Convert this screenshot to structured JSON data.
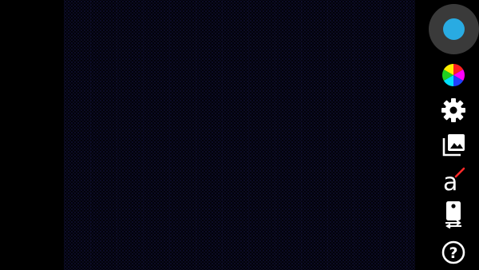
{
  "colors": {
    "background": "#000000",
    "shutter_ring": "#3a3a3a",
    "shutter_dot": "#29abe2",
    "icon": "#ffffff",
    "font_icon_accent": "#ff2a2a"
  },
  "toolbar": {
    "items": [
      {
        "name": "color-filter",
        "icon": "color-wheel-icon"
      },
      {
        "name": "settings",
        "icon": "gear-icon"
      },
      {
        "name": "gallery",
        "icon": "photo-library-icon"
      },
      {
        "name": "font",
        "icon": "font-style-icon",
        "glyph": "a"
      },
      {
        "name": "switch-camera",
        "icon": "switch-camera-icon"
      },
      {
        "name": "help",
        "icon": "help-icon",
        "glyph": "?"
      }
    ]
  }
}
